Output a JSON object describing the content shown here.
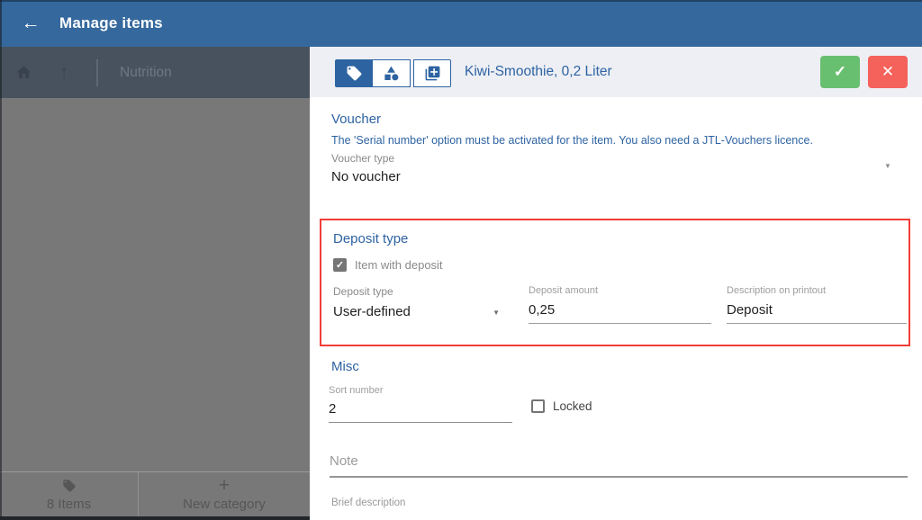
{
  "colors": {
    "appbar_blue": "#35689c",
    "accent_blue": "#2e63a2",
    "toolbar_band": "#edeff4",
    "sidebar_header": "#47525e",
    "sidebar_body": "#787878",
    "confirm_green": "#69bf70",
    "cancel_red": "#f4625b",
    "highlight_outline_red": "#f23d38"
  },
  "icons": {
    "back": "←",
    "up_arrow": "↑",
    "plus": "+",
    "check": "✓",
    "close": "✕",
    "caret_down": "▼",
    "tag": "tag-icon",
    "home": "home-icon",
    "variants": "shapes-icon",
    "copy_add": "copy-plus-icon"
  },
  "app_bar": {
    "title": "Manage items"
  },
  "sidebar": {
    "breadcrumb": "Nutrition",
    "items_count": "8 Items",
    "new_category": "New category"
  },
  "toolbar": {
    "item_title": "Kiwi-Smoothie, 0,2 Liter"
  },
  "voucher": {
    "heading": "Voucher",
    "hint": "The 'Serial number' option must be activated for the item. You also need a JTL-Vouchers licence.",
    "type_label": "Voucher type",
    "type_value": "No voucher"
  },
  "deposit": {
    "heading": "Deposit type",
    "with_deposit_label": "Item with deposit",
    "with_deposit_checked": true,
    "type_label": "Deposit type",
    "type_value": "User-defined",
    "amount_label": "Deposit amount",
    "amount_value": "0,25",
    "printout_label": "Description on printout",
    "printout_value": "Deposit"
  },
  "misc": {
    "heading": "Misc",
    "sort_label": "Sort number",
    "sort_value": "2",
    "locked_label": "Locked",
    "locked_checked": false
  },
  "note": {
    "placeholder": "Note"
  },
  "brief": {
    "label": "Brief description"
  }
}
